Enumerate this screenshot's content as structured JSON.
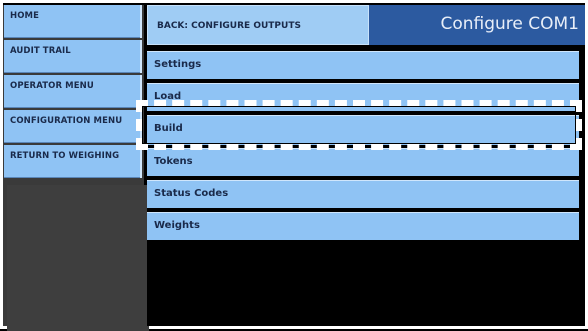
{
  "nav": {
    "items": [
      {
        "label": "HOME"
      },
      {
        "label": "AUDIT TRAIL"
      },
      {
        "label": "OPERATOR MENU"
      },
      {
        "label": "CONFIGURATION MENU"
      },
      {
        "label": "RETURN TO WEIGHING"
      }
    ]
  },
  "header": {
    "back_label": "BACK: CONFIGURE OUTPUTS",
    "title": "Configure COM1"
  },
  "menu": {
    "items": [
      {
        "label": "Settings"
      },
      {
        "label": "Load"
      },
      {
        "label": "Build"
      },
      {
        "label": "Tokens"
      },
      {
        "label": "Status Codes"
      },
      {
        "label": "Weights"
      }
    ],
    "highlighted_item": "Build"
  },
  "colors": {
    "button_blue": "#8fc3f4",
    "title_blue": "#2c5aa0",
    "background": "#000000",
    "nav_background": "#3a3a3a"
  }
}
